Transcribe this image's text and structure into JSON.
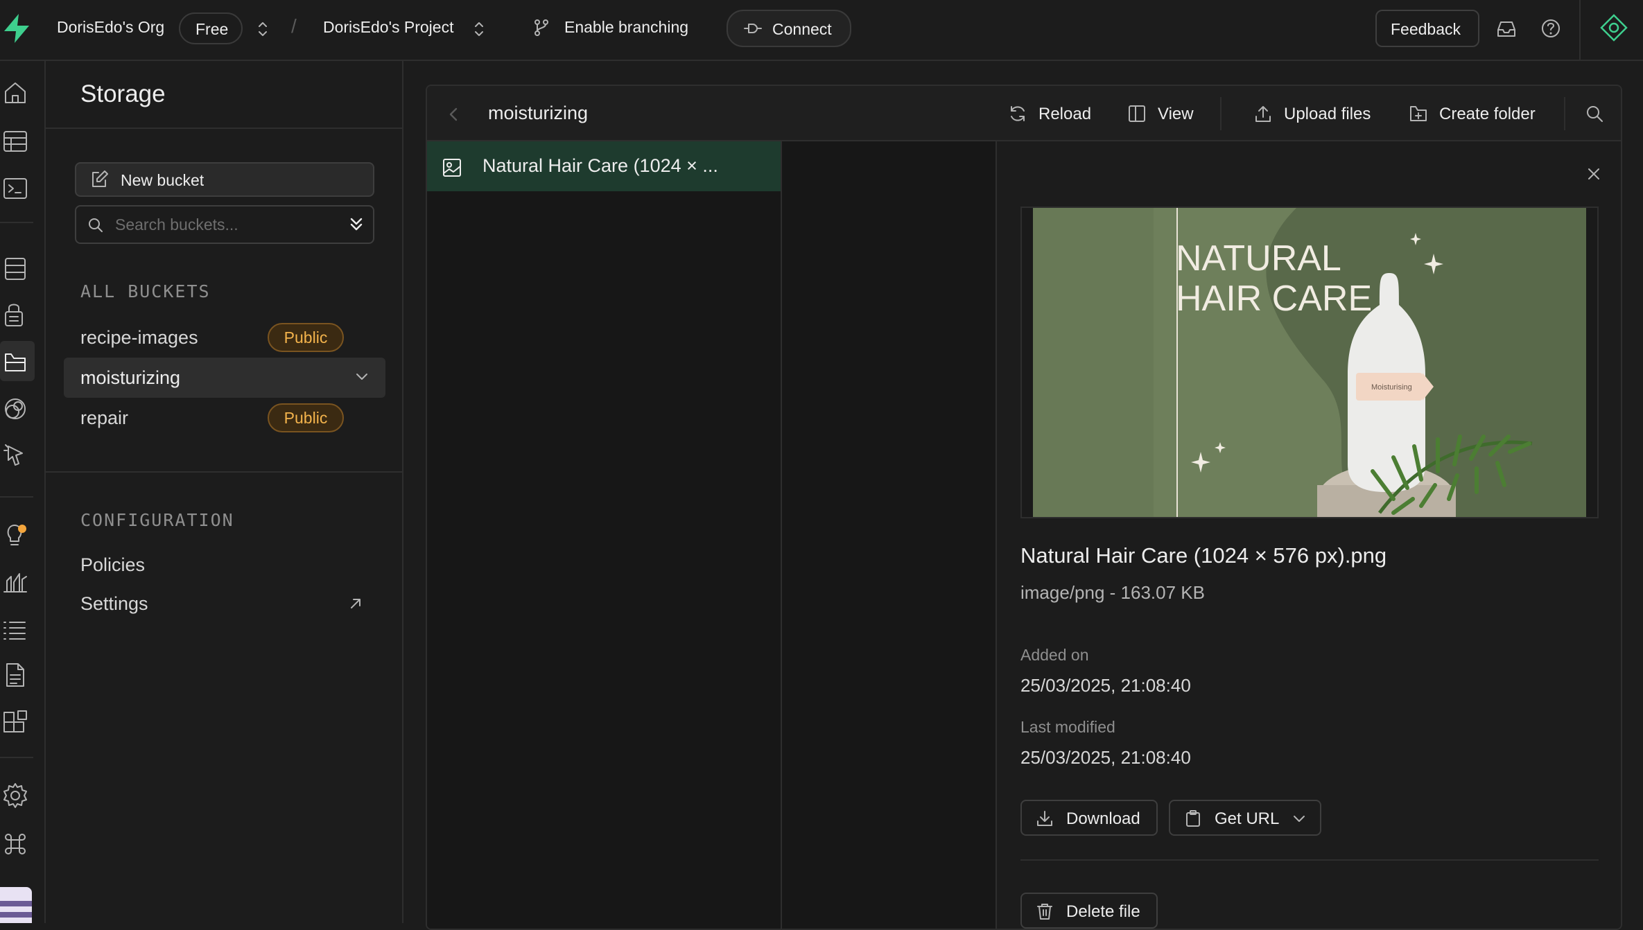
{
  "topbar": {
    "org_name": "DorisEdo's Org",
    "plan_badge": "Free",
    "project_name": "DorisEdo's Project",
    "branching_label": "Enable branching",
    "connect_label": "Connect",
    "feedback_label": "Feedback"
  },
  "rail": {
    "icons": [
      "home-icon",
      "table-editor-icon",
      "sql-editor-icon",
      "database-icon",
      "auth-icon",
      "storage-icon",
      "edge-functions-icon",
      "realtime-icon",
      "advisors-icon",
      "reports-icon",
      "logs-icon",
      "api-docs-icon",
      "integrations-icon",
      "settings-icon",
      "command-icon"
    ],
    "active": "storage-icon"
  },
  "sidebar": {
    "title": "Storage",
    "new_bucket_label": "New bucket",
    "search_placeholder": "Search buckets...",
    "buckets_section_label": "ALL BUCKETS",
    "buckets": [
      {
        "name": "recipe-images",
        "badge": "Public"
      },
      {
        "name": "moisturizing",
        "badge": ""
      },
      {
        "name": "repair",
        "badge": "Public"
      }
    ],
    "config_section_label": "CONFIGURATION",
    "config_items": [
      {
        "label": "Policies"
      },
      {
        "label": "Settings"
      }
    ]
  },
  "browser": {
    "current_bucket": "moisturizing",
    "actions": {
      "reload": "Reload",
      "view": "View",
      "upload": "Upload files",
      "create_folder": "Create folder"
    },
    "files": [
      {
        "name": "Natural Hair Care (1024 × ..."
      }
    ]
  },
  "preview": {
    "image_headline_line1": "NATURAL",
    "image_headline_line2": "HAIR CARE",
    "image_bottle_label": "Moisturising",
    "file_name": "Natural Hair Care (1024 × 576 px).png",
    "file_meta": "image/png - 163.07 KB",
    "added_label": "Added on",
    "added_value": "25/03/2025, 21:08:40",
    "modified_label": "Last modified",
    "modified_value": "25/03/2025, 21:08:40",
    "download_label": "Download",
    "get_url_label": "Get URL",
    "delete_label": "Delete file"
  },
  "colors": {
    "background": "#1c1c1c",
    "brand": "#3ecf8e",
    "selected_row": "#1e3b2e",
    "public_badge_text": "#f3b34c",
    "preview_bg": "#6e7f5b"
  }
}
